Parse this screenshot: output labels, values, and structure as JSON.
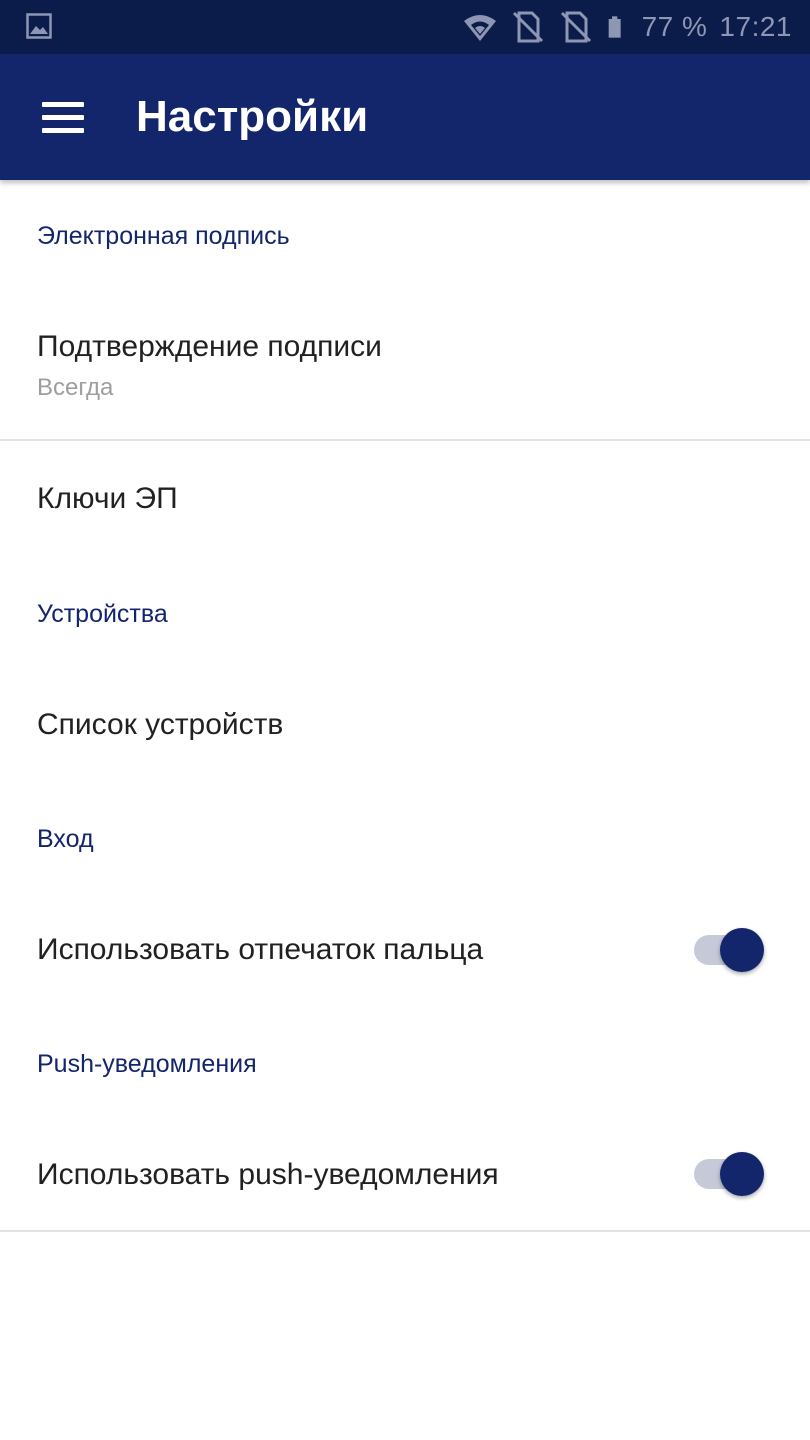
{
  "status_bar": {
    "battery_percent": "77 %",
    "time": "17:21",
    "icons": [
      "gallery-notification-icon",
      "wifi-icon",
      "no-sim-icon",
      "no-sim-icon",
      "battery-icon"
    ]
  },
  "app_bar": {
    "title": "Настройки",
    "menu_icon": "hamburger-menu-icon",
    "color": "#13256b"
  },
  "sections": [
    {
      "header": "Электронная подпись",
      "items": [
        {
          "title": "Подтверждение подписи",
          "summary": "Всегда"
        },
        {
          "title": "Ключи ЭП"
        }
      ]
    },
    {
      "header": "Устройства",
      "items": [
        {
          "title": "Список устройств"
        }
      ]
    },
    {
      "header": "Вход",
      "items": [
        {
          "title": "Использовать отпечаток пальца",
          "switch_on": true
        }
      ]
    },
    {
      "header": "Push-уведомления",
      "items": [
        {
          "title": "Использовать push-уведомления",
          "switch_on": true
        }
      ]
    }
  ]
}
